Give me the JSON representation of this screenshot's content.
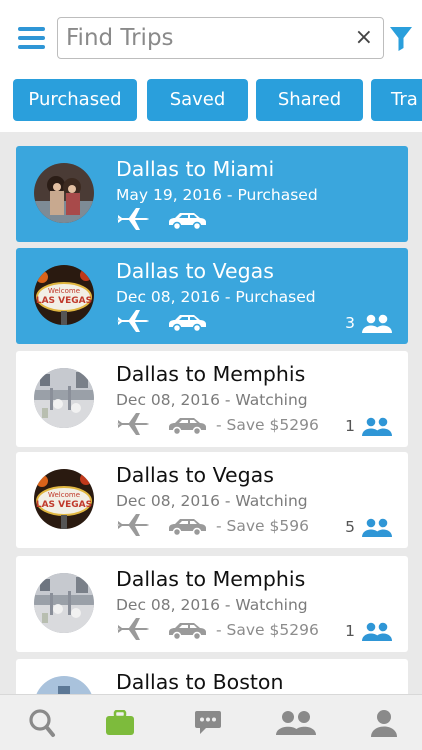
{
  "search": {
    "placeholder": "Find Trips",
    "value": "",
    "clear_label": "×"
  },
  "tabs": [
    {
      "label": "Purchased"
    },
    {
      "label": "Saved"
    },
    {
      "label": "Shared"
    },
    {
      "label": "Tra"
    }
  ],
  "trips": [
    {
      "title": "Dallas to Miami",
      "subtitle": "May 19, 2016 - Purchased",
      "save": "",
      "count": "",
      "active": true,
      "image": "friends-photo"
    },
    {
      "title": "Dallas to Vegas",
      "subtitle": "Dec 08, 2016 - Purchased",
      "save": "",
      "count": "3",
      "active": true,
      "image": "las-vegas-sign"
    },
    {
      "title": "Dallas to Memphis",
      "subtitle": "Dec 08, 2016 - Watching",
      "save": "- Save $5296",
      "count": "1",
      "active": false,
      "image": "restaurant-photo"
    },
    {
      "title": "Dallas to Vegas",
      "subtitle": "Dec 08, 2016 - Watching",
      "save": "- Save $596",
      "count": "5",
      "active": false,
      "image": "las-vegas-sign"
    },
    {
      "title": "Dallas to Memphis",
      "subtitle": "Dec 08, 2016 - Watching",
      "save": "- Save $5296",
      "count": "1",
      "active": false,
      "image": "restaurant-photo"
    },
    {
      "title": "Dallas to Boston",
      "subtitle": "",
      "save": "",
      "count": "",
      "active": false,
      "image": "city-photo"
    }
  ],
  "nav": [
    {
      "icon": "search-icon"
    },
    {
      "icon": "briefcase-icon",
      "active": true
    },
    {
      "icon": "chat-icon"
    },
    {
      "icon": "group-icon"
    },
    {
      "icon": "profile-icon"
    }
  ],
  "colors": {
    "accent": "#2a9fdc",
    "active_card": "#3aa6dd",
    "nav_active": "#7dbb3c",
    "icon_grey": "#8a8a8a"
  }
}
